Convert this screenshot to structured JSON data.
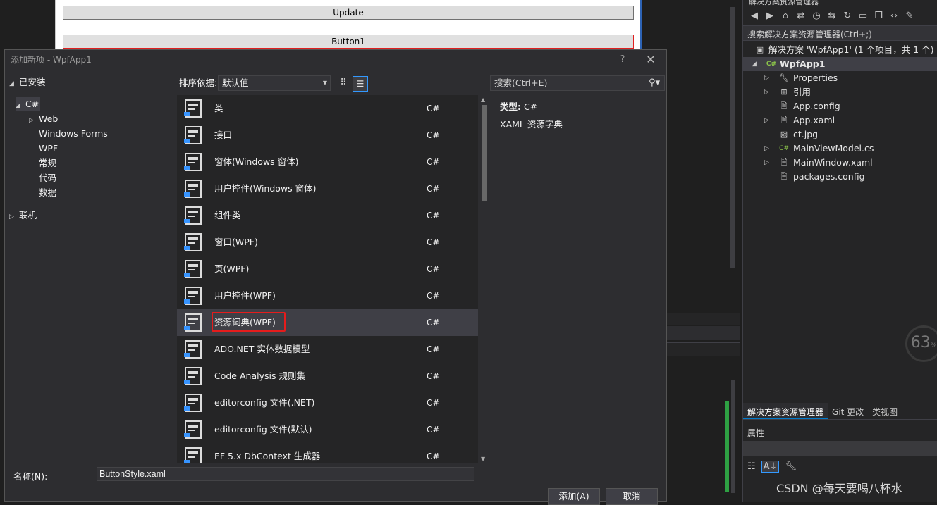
{
  "designer": {
    "update_button": "Update",
    "button1": "Button1"
  },
  "solution_explorer": {
    "title": "解决方案资源管理器",
    "search_placeholder": "搜索解决方案资源管理器(Ctrl+;)",
    "solution_label": "解决方案 'WpfApp1' (1 个项目，共 1 个)",
    "project": "WpfApp1",
    "items": [
      {
        "label": "Properties",
        "icon": "wrench-icon"
      },
      {
        "label": "引用",
        "icon": "references-icon"
      },
      {
        "label": "App.config",
        "icon": "config-file-icon"
      },
      {
        "label": "App.xaml",
        "icon": "xaml-file-icon"
      },
      {
        "label": "ct.jpg",
        "icon": "image-file-icon"
      },
      {
        "label": "MainViewModel.cs",
        "icon": "csharp-file-icon"
      },
      {
        "label": "MainWindow.xaml",
        "icon": "xaml-file-icon"
      },
      {
        "label": "packages.config",
        "icon": "config-file-icon"
      }
    ],
    "tabs": [
      "解决方案资源管理器",
      "Git 更改",
      "类视图"
    ],
    "properties_title": "属性",
    "percent": "63",
    "percent_unit": "%"
  },
  "watermark": "CSDN @每天要喝八杯水",
  "dialog": {
    "title": "添加新项 - WpfApp1",
    "help": "?",
    "close": "✕",
    "tree": {
      "installed": "已安装",
      "csharp": "C#",
      "children": [
        "Web",
        "Windows Forms",
        "WPF",
        "常规",
        "代码",
        "数据"
      ],
      "online": "联机"
    },
    "sort_label": "排序依据:",
    "sort_value": "默认值",
    "search_placeholder": "搜索(Ctrl+E)",
    "templates": [
      {
        "name": "类",
        "lang": "C#",
        "icon": "class-icon"
      },
      {
        "name": "接口",
        "lang": "C#",
        "icon": "interface-icon"
      },
      {
        "name": "窗体(Windows 窗体)",
        "lang": "C#",
        "icon": "form-icon"
      },
      {
        "name": "用户控件(Windows 窗体)",
        "lang": "C#",
        "icon": "user-control-icon"
      },
      {
        "name": "组件类",
        "lang": "C#",
        "icon": "component-icon"
      },
      {
        "name": "窗口(WPF)",
        "lang": "C#",
        "icon": "window-icon"
      },
      {
        "name": "页(WPF)",
        "lang": "C#",
        "icon": "page-icon"
      },
      {
        "name": "用户控件(WPF)",
        "lang": "C#",
        "icon": "user-control-icon"
      },
      {
        "name": "资源词典(WPF)",
        "lang": "C#",
        "icon": "resource-dictionary-icon"
      },
      {
        "name": "ADO.NET 实体数据模型",
        "lang": "C#",
        "icon": "entity-model-icon"
      },
      {
        "name": "Code Analysis 规则集",
        "lang": "C#",
        "icon": "ruleset-icon"
      },
      {
        "name": "editorconfig 文件(.NET)",
        "lang": "C#",
        "icon": "editorconfig-icon"
      },
      {
        "name": "editorconfig 文件(默认)",
        "lang": "C#",
        "icon": "editorconfig-icon"
      },
      {
        "name": "EF 5.x DbContext 生成器",
        "lang": "C#",
        "icon": "dbcontext-icon"
      }
    ],
    "selected_index": 8,
    "detail": {
      "type_label": "类型:",
      "type_value": "C#",
      "description": "XAML 资源字典"
    },
    "name_label": "名称(N):",
    "name_value": "ButtonStyle.xaml",
    "add_button": "添加(A)",
    "cancel_button": "取消"
  }
}
